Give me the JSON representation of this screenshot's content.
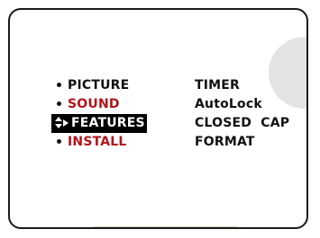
{
  "main_menu": {
    "items": [
      {
        "label": "PICTURE",
        "color": "#111111",
        "selected": false
      },
      {
        "label": "SOUND",
        "color": "#b3121b",
        "selected": false
      },
      {
        "label": "FEATURES",
        "color": "#ffffff",
        "selected": true
      },
      {
        "label": "INSTALL",
        "color": "#b3121b",
        "selected": false
      }
    ]
  },
  "submenu": {
    "items": [
      {
        "label": "TIMER"
      },
      {
        "label": "AutoLock"
      },
      {
        "label": "CLOSED  CAP"
      },
      {
        "label": "FORMAT"
      }
    ]
  },
  "icons": {
    "bullet": "bullet-icon",
    "cursor": "updown-right-cursor-icon"
  },
  "colors": {
    "highlight_bg": "#000000",
    "accent_red": "#b3121b",
    "text": "#111111"
  }
}
